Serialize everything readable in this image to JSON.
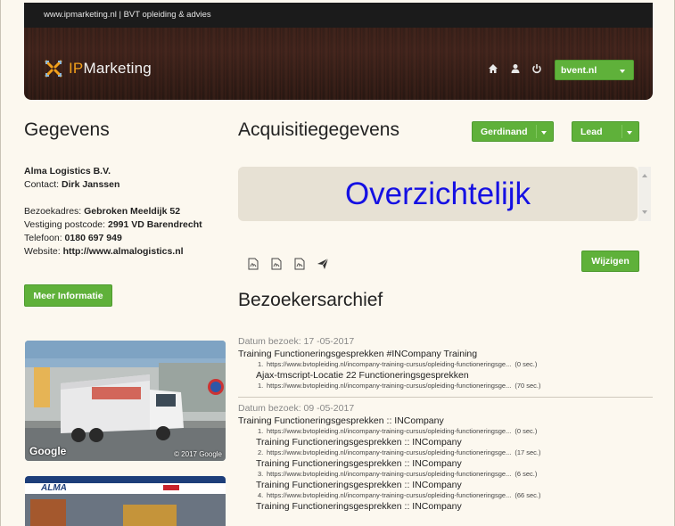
{
  "header": {
    "topbar_text": "www.ipmarketing.nl | BVT opleiding & advies",
    "logo_ip": "IP",
    "logo_rest": "Marketing",
    "icons": [
      "home-icon",
      "user-icon",
      "power-icon"
    ],
    "user_dropdown": "bvent.nl"
  },
  "left": {
    "heading": "Gegevens",
    "company": "Alma Logistics B.V.",
    "contact_label": "Contact: ",
    "contact_value": "Dirk Janssen",
    "address_label": "Bezoekadres: ",
    "address_value": "Gebroken Meeldijk 52",
    "postcode_label": "Vestiging postcode: ",
    "postcode_value": "2991 VD Barendrecht",
    "phone_label": "Telefoon: ",
    "phone_value": "0180 697 949",
    "website_label": "Website: ",
    "website_value": "http://www.almalogistics.nl",
    "more_button": "Meer Informatie",
    "photo_watermark": "Google",
    "photo_copyright": "© 2017 Google",
    "site_logo": "ALMA"
  },
  "acquisition": {
    "heading": "Acquisitiegegevens",
    "dropdown_person": "Gerdinand",
    "dropdown_status": "Lead",
    "overview_text": "Overzichtelijk",
    "edit_button": "Wijzigen",
    "doc_icons": [
      "pdf-icon",
      "pdf-icon",
      "pdf-icon",
      "send-icon"
    ]
  },
  "archive": {
    "heading": "Bezoekersarchief",
    "visits": [
      {
        "date": "Datum bezoek: 17 -05-2017",
        "title": "Training Functioneringsgesprekken #INCompany Training",
        "urls": [
          {
            "n": "1.",
            "url": "https://www.bvtopleiding.nl/incompany-training-cursus/opleiding-functioneringsge...",
            "time": "(0 sec.)"
          }
        ],
        "subs": [
          {
            "title": "Ajax-tmscript-Locatie 22 Functioneringsgesprekken",
            "urls": [
              {
                "n": "1.",
                "url": "https://www.bvtopleiding.nl/incompany-training-cursus/opleiding-functioneringsge...",
                "time": "(70 sec.)"
              }
            ]
          }
        ]
      },
      {
        "date": "Datum bezoek: 09 -05-2017",
        "title": "Training Functioneringsgesprekken :: INCompany",
        "urls": [
          {
            "n": "1.",
            "url": "https://www.bvtopleiding.nl/incompany-training-cursus/opleiding-functioneringsge...",
            "time": "(0 sec.)"
          }
        ],
        "subs": [
          {
            "title": "Training Functioneringsgesprekken :: INCompany",
            "urls": [
              {
                "n": "2.",
                "url": "https://www.bvtopleiding.nl/incompany-training-cursus/opleiding-functioneringsge...",
                "time": "(17 sec.)"
              }
            ]
          },
          {
            "title": "Training Functioneringsgesprekken :: INCompany",
            "urls": [
              {
                "n": "3.",
                "url": "https://www.bvtopleiding.nl/incompany-training-cursus/opleiding-functioneringsge...",
                "time": "(6 sec.)"
              }
            ]
          },
          {
            "title": "Training Functioneringsgesprekken :: INCompany",
            "urls": [
              {
                "n": "4.",
                "url": "https://www.bvtopleiding.nl/incompany-training-cursus/opleiding-functioneringsge...",
                "time": "(66 sec.)"
              }
            ]
          },
          {
            "title": "Training Functioneringsgesprekken :: INCompany",
            "urls": []
          }
        ]
      }
    ]
  },
  "colors": {
    "green": "#5fb13a",
    "overview_text": "#1510e3",
    "logo_orange": "#f2a01b"
  }
}
